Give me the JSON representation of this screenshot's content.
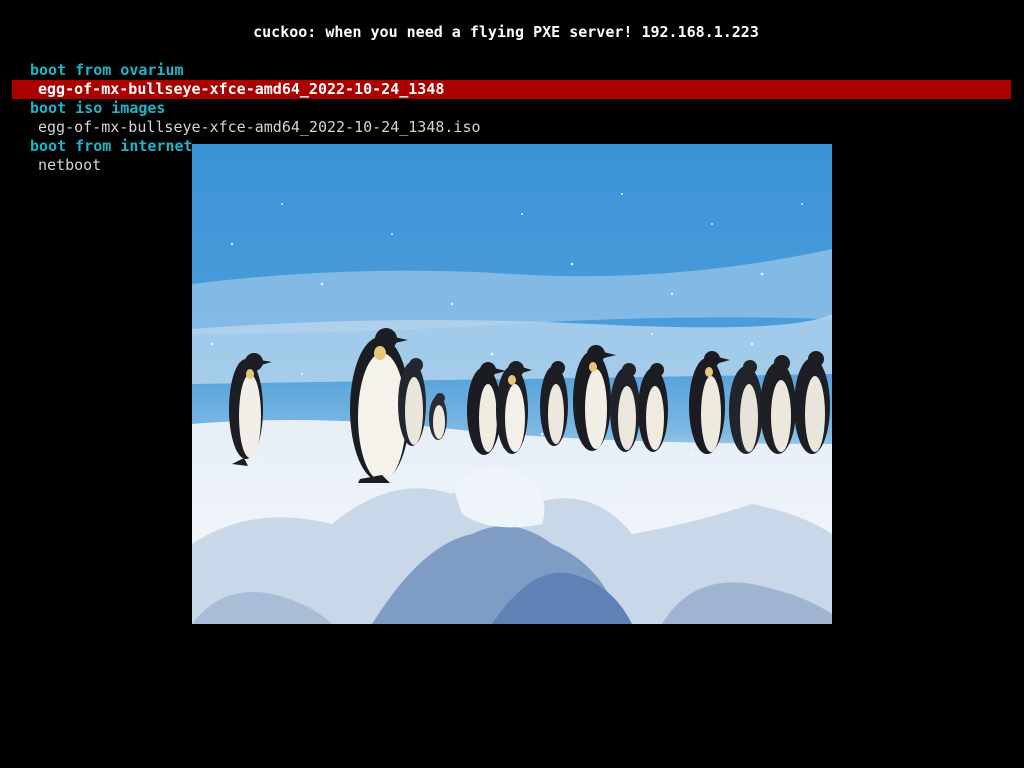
{
  "title": "cuckoo: when you need a flying PXE server! 192.168.1.223",
  "menu": [
    {
      "type": "header",
      "label": "boot from ovarium"
    },
    {
      "type": "entry",
      "label": "egg-of-mx-bullseye-xfce-amd64_2022-10-24_1348",
      "selected": true
    },
    {
      "type": "header",
      "label": "boot iso images"
    },
    {
      "type": "entry",
      "label": "egg-of-mx-bullseye-xfce-amd64_2022-10-24_1348.iso",
      "selected": false
    },
    {
      "type": "header",
      "label": "boot from internet"
    },
    {
      "type": "entry",
      "label": "netboot",
      "selected": false
    }
  ],
  "splash_image": {
    "subject": "emperor penguins on snow",
    "colors": {
      "sky_top": "#3f96d8",
      "sky_mid": "#6aaee0",
      "horizon": "#cfe0ee",
      "snow": "#f2f6fa",
      "snow_shadow": "#9fb7d3",
      "penguin_back": "#1a1c22",
      "penguin_belly": "#f4f2ea",
      "penguin_yellow": "#e8c67a"
    }
  },
  "colors": {
    "background": "#000000",
    "header_text": "#1fb4c8",
    "entry_text": "#d4d4d4",
    "highlight_bg": "#aa0000",
    "title_text": "#ffffff"
  }
}
